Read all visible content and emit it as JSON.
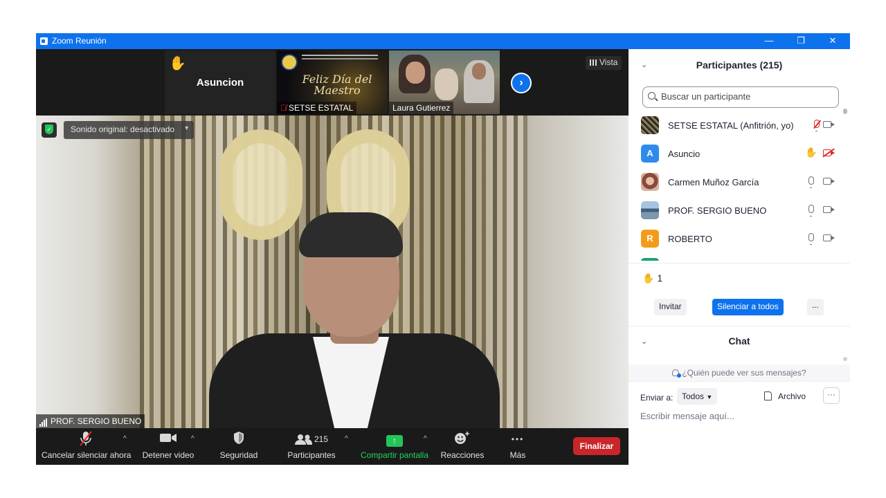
{
  "window": {
    "title": "Zoom Reunión",
    "controls": {
      "minimize": "—",
      "restore": "❐",
      "close": "✕"
    }
  },
  "strip": {
    "tiles": [
      {
        "name": "Asuncion",
        "hand": "✋"
      },
      {
        "name": "SETSE ESTATAL",
        "banner_text": "Feliz Día del Maestro",
        "muted": true
      },
      {
        "name": "Laura Gutierrez"
      }
    ],
    "next_icon": "›",
    "view_label": "Vista"
  },
  "main_video": {
    "sound_label": "Sonido original: desactivado",
    "caret": "▾",
    "speaker_name": "PROF. SERGIO BUENO"
  },
  "toolbar": {
    "mute_label": "Cancelar silenciar ahora",
    "video_label": "Detener video",
    "security_label": "Seguridad",
    "participants_label": "Participantes",
    "participants_count": "215",
    "share_label": "Compartir pantalla",
    "reactions_label": "Reacciones",
    "more_label": "Más",
    "more_icon": "•••",
    "caret": "^",
    "end_label": "Finalizar",
    "colors": {
      "share": "#23c45a",
      "end": "#c8262a"
    }
  },
  "panel": {
    "title": "Participantes (215)",
    "search_placeholder": "Buscar un participante",
    "participants": [
      {
        "name": "SETSE ESTATAL (Anfitrión, yo)",
        "avatar_letter": "",
        "avatar_color": "#4a4436",
        "mic": "off",
        "cam": "on"
      },
      {
        "name": "Asuncio",
        "avatar_letter": "A",
        "avatar_color": "#2d8ceb",
        "hand": "✋",
        "mic": "none",
        "cam": "off"
      },
      {
        "name": "Carmen Muñoz García",
        "avatar_letter": "",
        "avatar_color": "#b86a5a",
        "mic": "on",
        "cam": "on"
      },
      {
        "name": "PROF. SERGIO BUENO",
        "avatar_letter": "",
        "avatar_color": "#5d7a9e",
        "mic": "on",
        "cam": "on"
      },
      {
        "name": "ROBERTO",
        "avatar_letter": "R",
        "avatar_color": "#f39c1a",
        "mic": "on",
        "cam": "on"
      },
      {
        "name": "",
        "avatar_letter": "",
        "avatar_color": "#1aa37a",
        "mic": "on",
        "cam": "none"
      }
    ],
    "raised_hand_icon": "✋",
    "raised_hand_count": "1",
    "invite_label": "Invitar",
    "mute_all_label": "Silenciar a todos",
    "more_label": "...",
    "collapse_icon": "⌄"
  },
  "chat": {
    "title": "Chat",
    "who_sees_label": "¿Quién puede ver sus mensajes?",
    "send_to_label": "Enviar a:",
    "recipient": "Todos",
    "file_label": "Archivo",
    "more_label": "···",
    "input_placeholder": "Escribir mensaje aquí..."
  },
  "accent_color": "#0e72ed"
}
